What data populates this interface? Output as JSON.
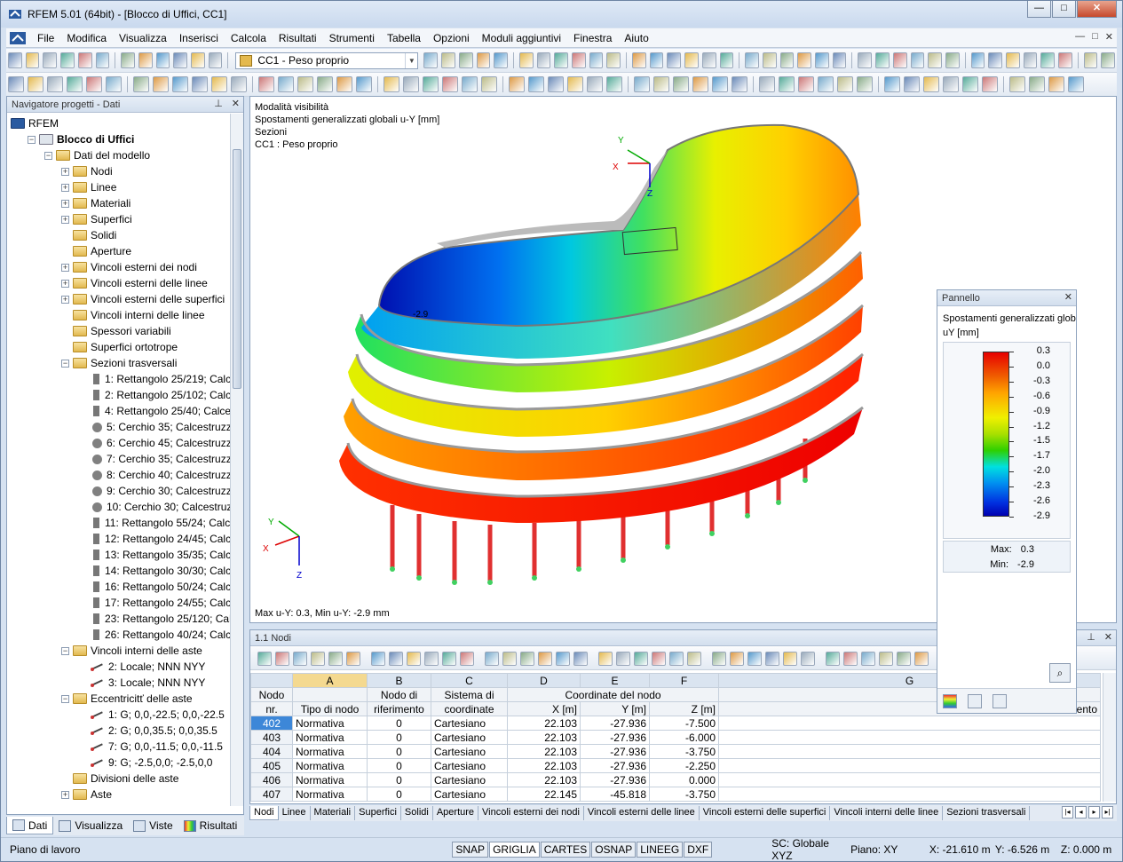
{
  "window": {
    "title": "RFEM 5.01 (64bit) - [Blocco di Uffici, CC1]",
    "minimize": "—",
    "maximize": "□",
    "close": "✕"
  },
  "menu": [
    "File",
    "Modifica",
    "Visualizza",
    "Inserisci",
    "Calcola",
    "Risultati",
    "Strumenti",
    "Tabella",
    "Opzioni",
    "Moduli aggiuntivi",
    "Finestra",
    "Aiuto"
  ],
  "mdi_controls": [
    "—",
    "□",
    "✕"
  ],
  "toolbar": {
    "load_case": "CC1 - Peso proprio"
  },
  "navigator": {
    "title": "Navigatore progetti - Dati",
    "pin": "⊥",
    "close": "✕",
    "items": [
      {
        "label": "RFEM",
        "level": 0,
        "icon": "rfem-logo-icon"
      },
      {
        "label": "Blocco di Uffici",
        "level": 1,
        "icon": "project-icon",
        "bold": true
      },
      {
        "label": "Dati del modello",
        "level": 2,
        "icon": "folder-icon"
      },
      {
        "label": "Nodi",
        "level": 3,
        "icon": "folder-icon"
      },
      {
        "label": "Linee",
        "level": 3,
        "icon": "folder-icon"
      },
      {
        "label": "Materiali",
        "level": 3,
        "icon": "folder-icon"
      },
      {
        "label": "Superfici",
        "level": 3,
        "icon": "folder-icon"
      },
      {
        "label": "Solidi",
        "level": 3,
        "icon": "folder-icon"
      },
      {
        "label": "Aperture",
        "level": 3,
        "icon": "folder-icon"
      },
      {
        "label": "Vincoli esterni dei nodi",
        "level": 3,
        "icon": "folder-icon"
      },
      {
        "label": "Vincoli esterni delle linee",
        "level": 3,
        "icon": "folder-icon"
      },
      {
        "label": "Vincoli esterni delle superfici",
        "level": 3,
        "icon": "folder-icon"
      },
      {
        "label": "Vincoli interni delle linee",
        "level": 3,
        "icon": "folder-icon"
      },
      {
        "label": "Spessori variabili",
        "level": 3,
        "icon": "folder-icon"
      },
      {
        "label": "Superfici ortotrope",
        "level": 3,
        "icon": "folder-icon"
      },
      {
        "label": "Sezioni trasversali",
        "level": 3,
        "icon": "folder-icon"
      },
      {
        "label": "1: Rettangolo 25/219; Calce",
        "level": 4,
        "icon": "rect-section-icon"
      },
      {
        "label": "2: Rettangolo 25/102; Calce",
        "level": 4,
        "icon": "rect-section-icon"
      },
      {
        "label": "4: Rettangolo 25/40; Calces",
        "level": 4,
        "icon": "rect-section-icon"
      },
      {
        "label": "5: Cerchio 35; Calcestruzzo",
        "level": 4,
        "icon": "circle-section-icon"
      },
      {
        "label": "6: Cerchio 45; Calcestruzzo",
        "level": 4,
        "icon": "circle-section-icon"
      },
      {
        "label": "7: Cerchio 35; Calcestruzzo",
        "level": 4,
        "icon": "circle-section-icon"
      },
      {
        "label": "8: Cerchio 40; Calcestruzzo",
        "level": 4,
        "icon": "circle-section-icon"
      },
      {
        "label": "9: Cerchio 30; Calcestruzzo",
        "level": 4,
        "icon": "circle-section-icon"
      },
      {
        "label": "10: Cerchio 30; Calcestruzzo",
        "level": 4,
        "icon": "circle-section-icon"
      },
      {
        "label": "11: Rettangolo 55/24; Calce",
        "level": 4,
        "icon": "rect-section-icon"
      },
      {
        "label": "12: Rettangolo 24/45; Calce",
        "level": 4,
        "icon": "rect-section-icon"
      },
      {
        "label": "13: Rettangolo 35/35; Calce",
        "level": 4,
        "icon": "rect-section-icon"
      },
      {
        "label": "14: Rettangolo 30/30; Calce",
        "level": 4,
        "icon": "rect-section-icon"
      },
      {
        "label": "16: Rettangolo 50/24; Calce",
        "level": 4,
        "icon": "rect-section-icon"
      },
      {
        "label": "17: Rettangolo 24/55; Calce",
        "level": 4,
        "icon": "rect-section-icon"
      },
      {
        "label": "23: Rettangolo 25/120; Calc",
        "level": 4,
        "icon": "rect-section-icon"
      },
      {
        "label": "26: Rettangolo 40/24; Calce",
        "level": 4,
        "icon": "rect-section-icon"
      },
      {
        "label": "Vincoli interni delle aste",
        "level": 3,
        "icon": "folder-icon"
      },
      {
        "label": "2: Locale; NNN NYY",
        "level": 4,
        "icon": "hinge-icon"
      },
      {
        "label": "3: Locale; NNN NYY",
        "level": 4,
        "icon": "hinge-icon"
      },
      {
        "label": "Eccentricitť delle aste",
        "level": 3,
        "icon": "folder-icon"
      },
      {
        "label": "1: G; 0,0,-22.5; 0,0,-22.5",
        "level": 4,
        "icon": "eccentricity-icon"
      },
      {
        "label": "2: G; 0,0,35.5; 0,0,35.5",
        "level": 4,
        "icon": "eccentricity-icon"
      },
      {
        "label": "7: G; 0,0,-11.5; 0,0,-11.5",
        "level": 4,
        "icon": "eccentricity-icon"
      },
      {
        "label": "9: G; -2.5,0,0; -2.5,0,0",
        "level": 4,
        "icon": "eccentricity-icon"
      },
      {
        "label": "Divisioni delle aste",
        "level": 3,
        "icon": "folder-icon"
      },
      {
        "label": "Aste",
        "level": 3,
        "icon": "folder-icon"
      }
    ],
    "tabs": [
      "Dati",
      "Visualizza",
      "Viste",
      "Risultati"
    ]
  },
  "view": {
    "info": [
      "Modalità visibilità",
      "Spostamenti generalizzati globali u-Y [mm]",
      "Sezioni",
      "CC1 : Peso proprio"
    ],
    "footer": "Max u-Y: 0.3, Min u-Y: -2.9 mm",
    "axes": {
      "x": "X",
      "y": "Y",
      "z": "Z"
    },
    "min_label": "-2.9"
  },
  "panel": {
    "title": "Pannello",
    "close": "✕",
    "heading": "Spostamenti generalizzati globa",
    "unit": "uY [mm]",
    "legend_values": [
      "0.3",
      "0.0",
      "-0.3",
      "-0.6",
      "-0.9",
      "-1.2",
      "-1.5",
      "-1.7",
      "-2.0",
      "-2.3",
      "-2.6",
      "-2.9"
    ],
    "max_label": "Max:",
    "max_value": "0.3",
    "min_label": "Min:",
    "min_value": "-2.9"
  },
  "table": {
    "title": "1.1 Nodi",
    "col_letters": [
      "A",
      "B",
      "C",
      "D",
      "E",
      "F",
      "G"
    ],
    "header_row1": {
      "node": "Nodo",
      "ref": "Nodo di",
      "sys": "Sistema di",
      "coords": "Coordinate del nodo"
    },
    "header_row2": {
      "node": "nr.",
      "type": "Tipo di nodo",
      "ref": "riferimento",
      "sys": "coordinate",
      "x": "X [m]",
      "y": "Y [m]",
      "z": "Z [m]",
      "comment": "Commento"
    },
    "rows": [
      {
        "nr": "402",
        "type": "Normativa",
        "ref": "0",
        "sys": "Cartesiano",
        "x": "22.103",
        "y": "-27.936",
        "z": "-7.500"
      },
      {
        "nr": "403",
        "type": "Normativa",
        "ref": "0",
        "sys": "Cartesiano",
        "x": "22.103",
        "y": "-27.936",
        "z": "-6.000"
      },
      {
        "nr": "404",
        "type": "Normativa",
        "ref": "0",
        "sys": "Cartesiano",
        "x": "22.103",
        "y": "-27.936",
        "z": "-3.750"
      },
      {
        "nr": "405",
        "type": "Normativa",
        "ref": "0",
        "sys": "Cartesiano",
        "x": "22.103",
        "y": "-27.936",
        "z": "-2.250"
      },
      {
        "nr": "406",
        "type": "Normativa",
        "ref": "0",
        "sys": "Cartesiano",
        "x": "22.103",
        "y": "-27.936",
        "z": "0.000"
      },
      {
        "nr": "407",
        "type": "Normativa",
        "ref": "0",
        "sys": "Cartesiano",
        "x": "22.145",
        "y": "-45.818",
        "z": "-3.750"
      }
    ],
    "sheet_tabs": [
      "Nodi",
      "Linee",
      "Materiali",
      "Superfici",
      "Solidi",
      "Aperture",
      "Vincoli esterni dei nodi",
      "Vincoli esterni delle linee",
      "Vincoli esterni delle superfici",
      "Vincoli interni delle linee",
      "Sezioni trasversali"
    ]
  },
  "status": {
    "left": "Piano di lavoro",
    "toggles": [
      "SNAP",
      "GRIGLIA",
      "CARTES",
      "OSNAP",
      "LINEEG",
      "DXF"
    ],
    "sc": "SC: Globale XYZ",
    "plane": "Piano: XY",
    "x": "X:  -21.610 m",
    "y": "Y:  -6.526 m",
    "z": "Z:  0.000 m"
  },
  "colors": {
    "accent": "#3d87d8",
    "title_bg": "#d6e2f1",
    "close_red": "#c6482b"
  }
}
